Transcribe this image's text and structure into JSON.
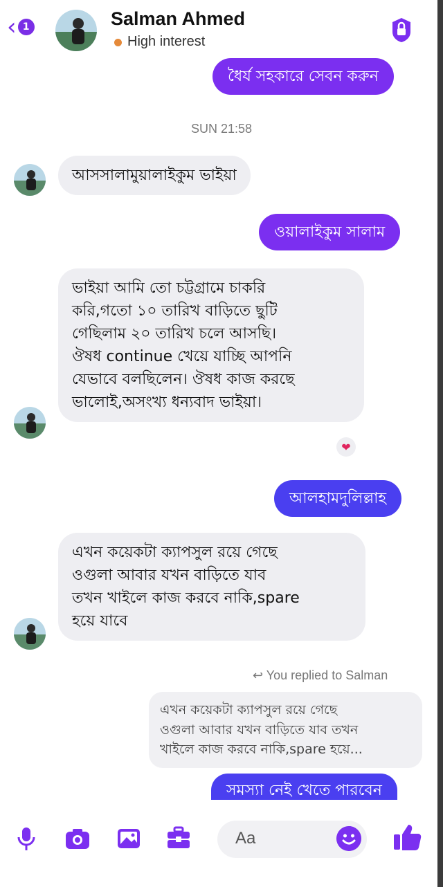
{
  "header": {
    "back_badge": "1",
    "contact_name": "Salman Ahmed",
    "status": "High interest",
    "status_color": "#e58a3a",
    "accent_color": "#7b2ff0"
  },
  "timestamp": "SUN 21:58",
  "messages": [
    {
      "from": "me",
      "text": "ধৈর্য সহকারে সেবন করুন"
    },
    {
      "from": "them",
      "text": "আসসালামুয়ালাইকুম ভাইয়া"
    },
    {
      "from": "me",
      "text": "ওয়ালাইকুম সালাম"
    },
    {
      "from": "them",
      "lines": [
        "ভাইয়া আমি তো চট্টগ্রামে চাকরি",
        "করি,গতো ১০ তারিখ বাড়িতে ছুটি",
        "গেছিলাম ২০ তারিখ চলে আসছি।",
        "ঔষধ continue খেয়ে যাচ্ছি আপনি",
        "যেভাবে বলছিলেন। ঔষধ কাজ করছে",
        "ভালোই,অসংখ্য ধন্যবাদ ভাইয়া।"
      ],
      "reaction": "❤"
    },
    {
      "from": "me",
      "text": "আলহামদুলিল্লাহ"
    },
    {
      "from": "them",
      "lines": [
        "এখন কয়েকটা ক্যাপসুল রয়ে গেছে",
        "ওগুলা আবার যখন বাড়িতে যাব",
        "তখন খাইলে কাজ করবে নাকি,spare",
        "হয়ে যাবে"
      ]
    },
    {
      "from": "me",
      "text": "সমস্যা নেই খেতে পারবেন"
    }
  ],
  "reply": {
    "label": "You replied to Salman",
    "quote_lines": [
      "এখন কয়েকটা ক্যাপসুল রয়ে গেছে",
      "ওগুলা আবার যখন বাড়িতে যাব তখন",
      "খাইলে কাজ করবে নাকি,spare হয়ে..."
    ]
  },
  "composer": {
    "placeholder": "Aa",
    "icons": [
      "microphone-icon",
      "camera-icon",
      "gallery-icon",
      "toolbox-icon",
      "emoji-icon",
      "thumbs-up-icon"
    ]
  }
}
